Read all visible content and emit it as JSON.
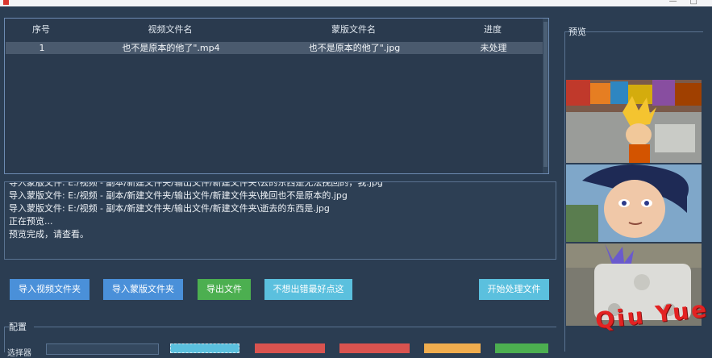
{
  "table": {
    "headers": [
      "序号",
      "视频文件名",
      "蒙版文件名",
      "进度"
    ],
    "rows": [
      {
        "index": "1",
        "video": "也不是原本的他了\".mp4",
        "mask": "也不是原本的他了\".jpg",
        "status": "未处理"
      }
    ]
  },
  "log": {
    "lines": [
      "导入蒙版文件: E:/视频 - 副本/新建文件夹/输出文件/新建文件夹\\去的东西是无法挽回的，我.jpg",
      "导入蒙版文件: E:/视频 - 副本/新建文件夹/输出文件/新建文件夹\\挽回也不是原本的.jpg",
      "导入蒙版文件: E:/视频 - 副本/新建文件夹/输出文件/新建文件夹\\逝去的东西是.jpg",
      "正在预览...",
      "预览完成，请查看。"
    ]
  },
  "actions": {
    "import_video_folder": "导入视频文件夹",
    "import_mask_folder": "导入蒙版文件夹",
    "export_file": "导出文件",
    "no_error_click": "不想出错最好点这",
    "start_processing": "开始处理文件"
  },
  "config": {
    "section_label": "配置",
    "field_label": "选择器"
  },
  "preview": {
    "label": "预览"
  },
  "watermark": "Qiu Yue",
  "colors": {
    "background": "#2b3d52",
    "button_blue": "#4a90d9",
    "button_green": "#4caf50",
    "button_cyan": "#5bc0de",
    "button_red": "#d9534f",
    "button_orange": "#f0ad4e",
    "watermark_red": "#e32222"
  }
}
